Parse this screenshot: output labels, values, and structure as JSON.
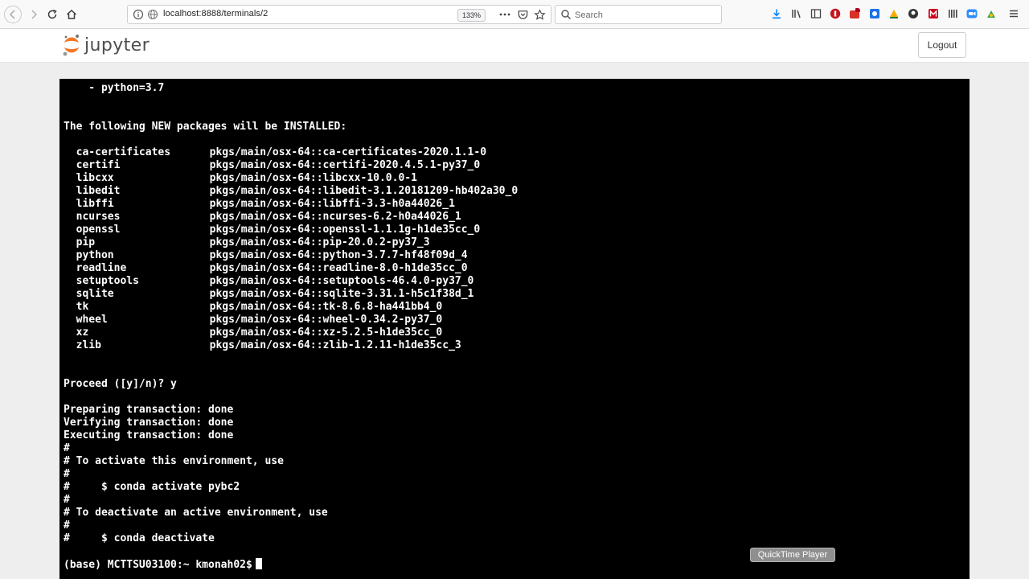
{
  "browser": {
    "url": "localhost:8888/terminals/2",
    "zoom": "133%",
    "search_placeholder": "Search"
  },
  "header": {
    "logo_text": "jupyter",
    "logout_label": "Logout"
  },
  "terminal": {
    "lines": [
      "    - python=3.7",
      "",
      "",
      "The following NEW packages will be INSTALLED:",
      "",
      {
        "name": "ca-certificates",
        "spec": "pkgs/main/osx-64::ca-certificates-2020.1.1-0"
      },
      {
        "name": "certifi",
        "spec": "pkgs/main/osx-64::certifi-2020.4.5.1-py37_0"
      },
      {
        "name": "libcxx",
        "spec": "pkgs/main/osx-64::libcxx-10.0.0-1"
      },
      {
        "name": "libedit",
        "spec": "pkgs/main/osx-64::libedit-3.1.20181209-hb402a30_0"
      },
      {
        "name": "libffi",
        "spec": "pkgs/main/osx-64::libffi-3.3-h0a44026_1"
      },
      {
        "name": "ncurses",
        "spec": "pkgs/main/osx-64::ncurses-6.2-h0a44026_1"
      },
      {
        "name": "openssl",
        "spec": "pkgs/main/osx-64::openssl-1.1.1g-h1de35cc_0"
      },
      {
        "name": "pip",
        "spec": "pkgs/main/osx-64::pip-20.0.2-py37_3"
      },
      {
        "name": "python",
        "spec": "pkgs/main/osx-64::python-3.7.7-hf48f09d_4"
      },
      {
        "name": "readline",
        "spec": "pkgs/main/osx-64::readline-8.0-h1de35cc_0"
      },
      {
        "name": "setuptools",
        "spec": "pkgs/main/osx-64::setuptools-46.4.0-py37_0"
      },
      {
        "name": "sqlite",
        "spec": "pkgs/main/osx-64::sqlite-3.31.1-h5c1f38d_1"
      },
      {
        "name": "tk",
        "spec": "pkgs/main/osx-64::tk-8.6.8-ha441bb4_0"
      },
      {
        "name": "wheel",
        "spec": "pkgs/main/osx-64::wheel-0.34.2-py37_0"
      },
      {
        "name": "xz",
        "spec": "pkgs/main/osx-64::xz-5.2.5-h1de35cc_0"
      },
      {
        "name": "zlib",
        "spec": "pkgs/main/osx-64::zlib-1.2.11-h1de35cc_3"
      },
      "",
      "",
      "Proceed ([y]/n)? y",
      "",
      "Preparing transaction: done",
      "Verifying transaction: done",
      "Executing transaction: done",
      "#",
      "# To activate this environment, use",
      "#",
      "#     $ conda activate pybc2",
      "#",
      "# To deactivate an active environment, use",
      "#",
      "#     $ conda deactivate",
      ""
    ],
    "prompt": "(base) MCTTSU03100:~ kmonah02$"
  },
  "overlay": {
    "tooltip": "QuickTime Player"
  },
  "colors": {
    "jupyter_orange": "#f37726",
    "terminal_bg": "#000000",
    "terminal_fg": "#ffffff"
  }
}
